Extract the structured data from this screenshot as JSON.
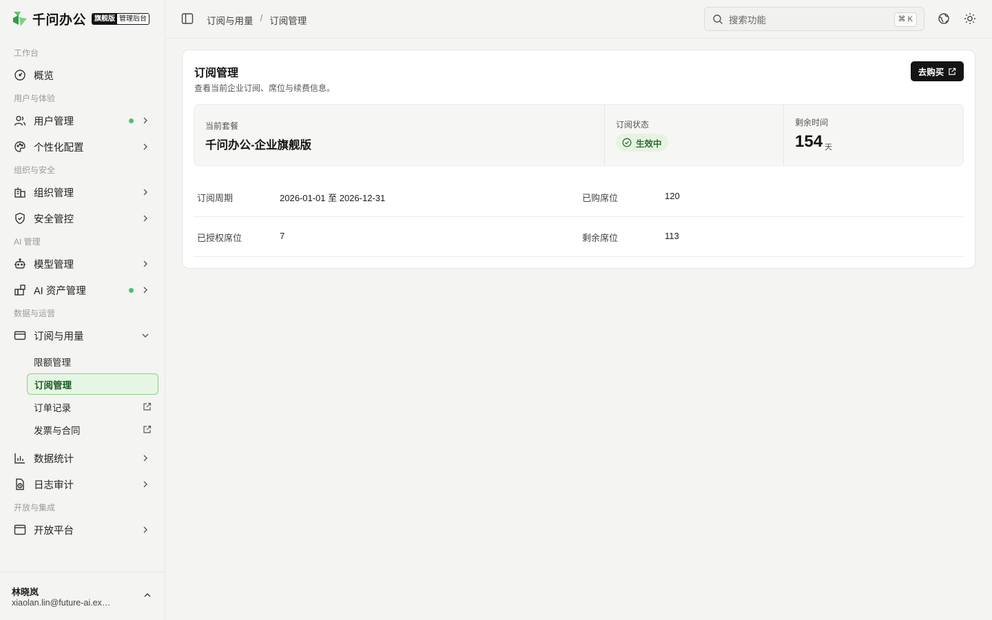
{
  "brand": {
    "name": "千问办公",
    "badge_edition": "旗舰版",
    "badge_admin": "管理后台"
  },
  "sidebar": {
    "sections": {
      "workbench": "工作台",
      "users": "用户与体验",
      "org": "组织与安全",
      "ai": "AI 管理",
      "data": "数据与运营",
      "open": "开放与集成"
    },
    "items": {
      "overview": "概览",
      "user_mgmt": "用户管理",
      "personalize": "个性化配置",
      "org_mgmt": "组织管理",
      "security": "安全管控",
      "model_mgmt": "模型管理",
      "ai_assets": "AI 资产管理",
      "subscription": "订阅与用量",
      "quota": "限额管理",
      "sub_mgmt": "订阅管理",
      "orders": "订单记录",
      "invoice": "发票与合同",
      "stats": "数据统计",
      "audit": "日志审计",
      "open_platform": "开放平台"
    },
    "user": {
      "name": "林晓岚",
      "email": "xiaolan.lin@future-ai.example.com"
    }
  },
  "topbar": {
    "breadcrumb": [
      "订阅与用量",
      "订阅管理"
    ],
    "breadcrumb_sep": "/",
    "search_placeholder": "搜索功能",
    "search_shortcut": "⌘ K"
  },
  "main": {
    "title": "订阅管理",
    "description": "查看当前企业订阅、席位与续费信息。",
    "buy_button": "去购买",
    "stats": {
      "plan_label": "当前套餐",
      "plan_value": "千问办公-企业旗舰版",
      "status_label": "订阅状态",
      "status_value": "生效中",
      "remaining_label": "剩余时间",
      "remaining_value": "154",
      "remaining_unit": "天"
    },
    "details": {
      "period_label": "订阅周期",
      "period_value": "2026-01-01 至 2026-12-31",
      "purchased_label": "已购席位",
      "purchased_value": "120",
      "authorized_label": "已授权席位",
      "authorized_value": "7",
      "remaining_seats_label": "剩余席位",
      "remaining_seats_value": "113"
    }
  },
  "colors": {
    "accent_green": "#4fbf6b",
    "active_bg": "#e6f6e4",
    "active_border": "#8ccf8a",
    "button_dark": "#141414"
  }
}
